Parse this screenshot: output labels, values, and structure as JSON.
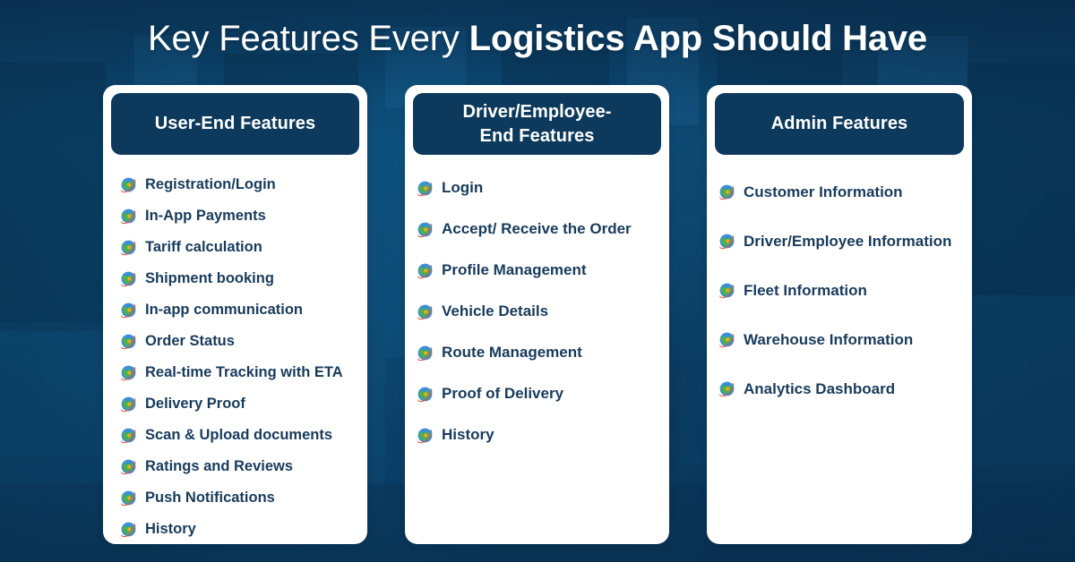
{
  "title": {
    "light_part": "Key Features Every ",
    "bold_part": "Logistics App Should Have"
  },
  "colors": {
    "background_blue": "#0c4a74",
    "card_header_navy": "#0d3a5c",
    "card_surface": "#ffffff",
    "item_text_navy": "#183b5c",
    "title_text": "#ffffff"
  },
  "bullet_icon": "globe-icon",
  "cards": [
    {
      "id": "user-end-features",
      "header_line1": "User-End Features",
      "header_line2": "",
      "items": [
        "Registration/Login",
        "In-App Payments",
        "Tariff calculation",
        "Shipment booking",
        "In-app communication",
        "Order Status",
        "Real-time Tracking with ETA",
        "Delivery Proof",
        "Scan & Upload documents",
        "Ratings and Reviews",
        "Push Notifications",
        "History"
      ]
    },
    {
      "id": "driver-employee-end-features",
      "header_line1": "Driver/Employee-",
      "header_line2": "End Features",
      "items": [
        "Login",
        "Accept/ Receive the Order",
        "Profile Management",
        "Vehicle Details",
        "Route Management",
        "Proof of Delivery",
        "History"
      ]
    },
    {
      "id": "admin-features",
      "header_line1": "Admin Features",
      "header_line2": "",
      "items": [
        "Customer Information",
        "Driver/Employee Information",
        "Fleet Information",
        "Warehouse Information",
        "Analytics Dashboard"
      ]
    }
  ]
}
